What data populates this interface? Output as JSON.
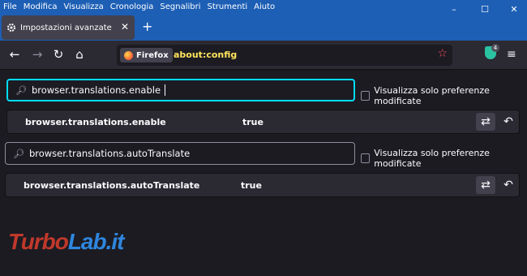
{
  "menubar": [
    "File",
    "Modifica",
    "Visualizza",
    "Cronologia",
    "Segnalibri",
    "Strumenti",
    "Aiuto"
  ],
  "window_controls": {
    "minimize": "–",
    "maximize": "☐",
    "close": "✕"
  },
  "tab": {
    "title": "Impostazioni avanzate",
    "close": "✕",
    "newtab": "+"
  },
  "nav": {
    "back": "←",
    "forward": "→",
    "reload": "↻",
    "home": "⌂"
  },
  "urlbar": {
    "identity": "Firefox",
    "url": "about:config",
    "star": "☆"
  },
  "extensions": {
    "badge": "4",
    "menu": "≡"
  },
  "search1": {
    "value": "browser.translations.enable",
    "checkbox": "Visualizza solo preferenze modificate"
  },
  "row1": {
    "name": "browser.translations.enable",
    "value": "true",
    "toggle": "⇄",
    "reset": "↶"
  },
  "search2": {
    "value": "browser.translations.autoTranslate",
    "checkbox": "Visualizza solo preferenze modificate"
  },
  "row2": {
    "name": "browser.translations.autoTranslate",
    "value": "true",
    "toggle": "⇄",
    "reset": "↶"
  },
  "watermark": {
    "part1": "Turbo",
    "part2": "Lab.it"
  },
  "colors": {
    "titlebar": "#1d5fb5",
    "background": "#1c1b22",
    "accent": "#00ddff",
    "url": "#ffe45c"
  }
}
